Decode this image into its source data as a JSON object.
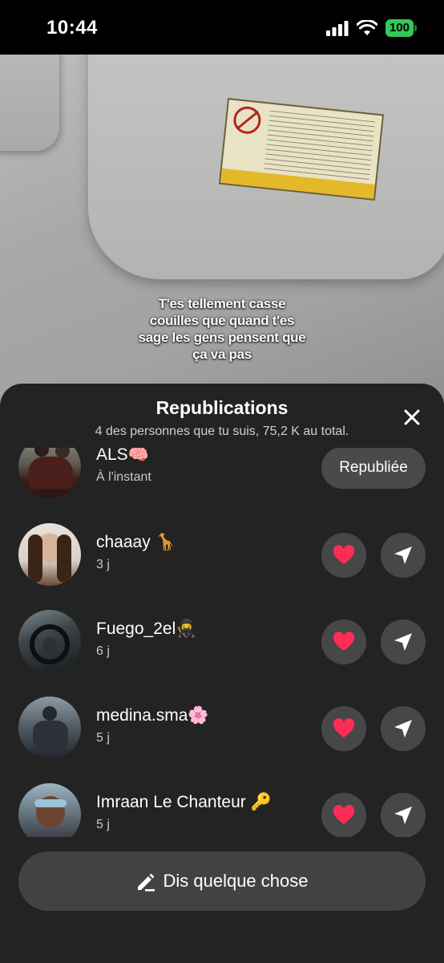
{
  "status_bar": {
    "time": "10:44",
    "battery": "100"
  },
  "video": {
    "caption_lines": [
      "T'es tellement casse",
      "couilles que quand t'es",
      "sage les gens pensent que",
      "ça va pas"
    ]
  },
  "sheet": {
    "title": "Republications",
    "subtitle": "4 des personnes que tu suis, 75,2 K au total."
  },
  "reposts": [
    {
      "name": "ALS🧠",
      "time": "À l'instant",
      "action_label": "Republiée"
    },
    {
      "name": "chaaay 🦒",
      "time": "3 j"
    },
    {
      "name": "Fuego_2el🥷",
      "time": "6 j"
    },
    {
      "name": "medina.sma🌸",
      "time": "5 j"
    },
    {
      "name": "Imraan Le Chanteur 🔑",
      "time": "5 j"
    }
  ],
  "composer": {
    "label": "Dis quelque chose"
  },
  "colors": {
    "sheet_bg": "#232323",
    "button_bg": "#474747",
    "heart": "#fe2c55",
    "battery": "#34c759"
  }
}
